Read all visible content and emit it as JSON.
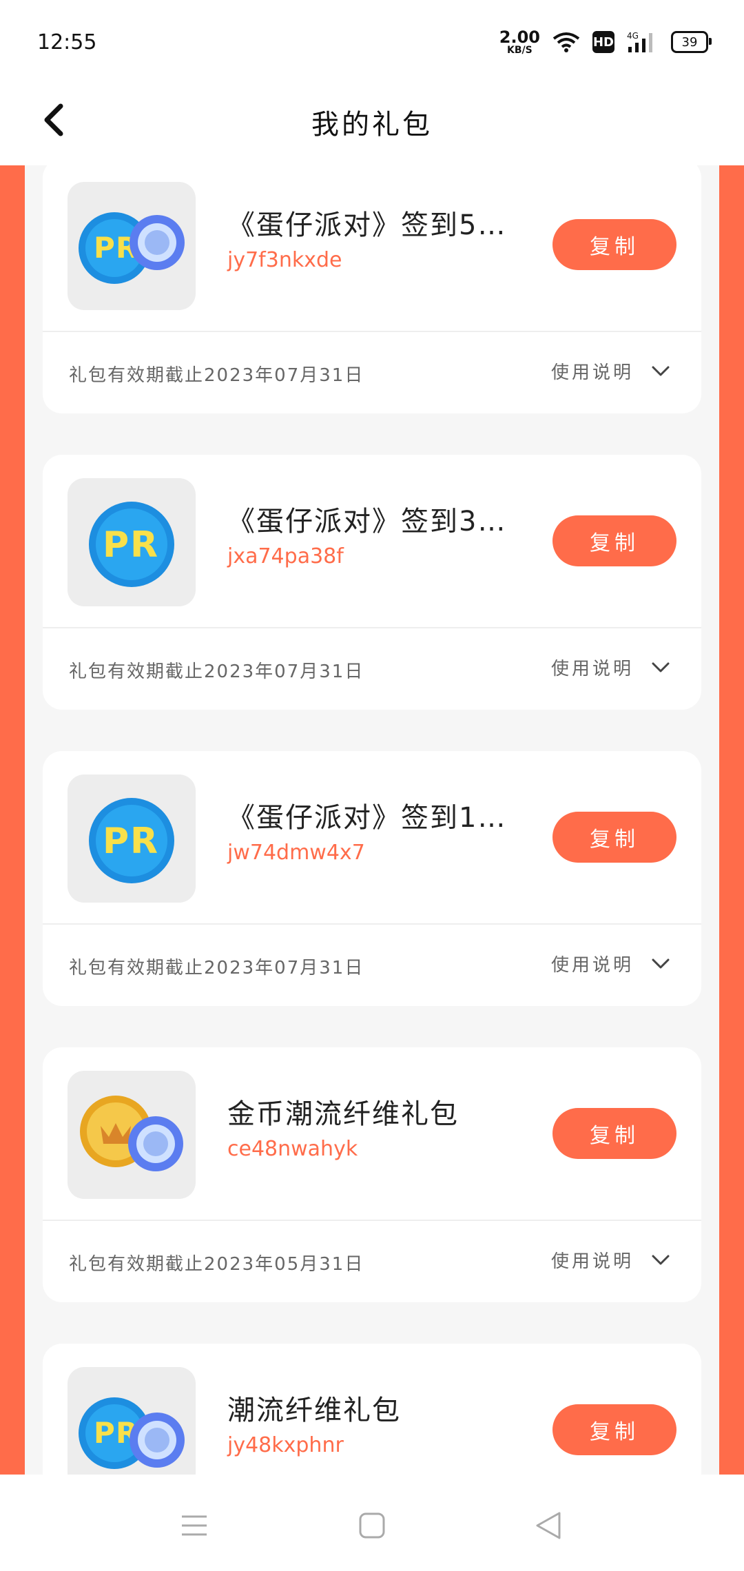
{
  "status_bar": {
    "time": "12:55",
    "net_speed_value": "2.00",
    "net_speed_unit": "KB/S",
    "hd_label": "HD",
    "network": "4G",
    "battery": "39"
  },
  "header": {
    "title": "我的礼包"
  },
  "gifts": [
    {
      "title": "《蛋仔派对》签到5…",
      "code": "jy7f3nkxde",
      "copy_label": "复制",
      "expire": "礼包有效期截止2023年07月31日",
      "usage_label": "使用说明",
      "icon": "bottle-cap-with-capsule"
    },
    {
      "title": "《蛋仔派对》签到3…",
      "code": "jxa74pa38f",
      "copy_label": "复制",
      "expire": "礼包有效期截止2023年07月31日",
      "usage_label": "使用说明",
      "icon": "bottle-cap"
    },
    {
      "title": "《蛋仔派对》签到1…",
      "code": "jw74dmw4x7",
      "copy_label": "复制",
      "expire": "礼包有效期截止2023年07月31日",
      "usage_label": "使用说明",
      "icon": "bottle-cap"
    },
    {
      "title": "金币潮流纤维礼包",
      "code": "ce48nwahyk",
      "copy_label": "复制",
      "expire": "礼包有效期截止2023年05月31日",
      "usage_label": "使用说明",
      "icon": "gold-coin-with-capsule"
    },
    {
      "title": "潮流纤维礼包",
      "code": "jy48kxphnr",
      "copy_label": "复制",
      "expire": "",
      "usage_label": "",
      "icon": "bottle-cap-with-capsule"
    }
  ],
  "colors": {
    "accent": "#ff6c4a",
    "background": "#f6f6f6",
    "card": "#ffffff"
  }
}
